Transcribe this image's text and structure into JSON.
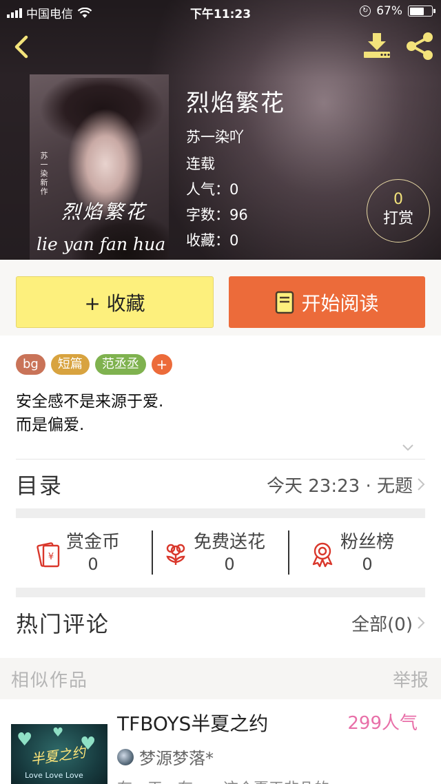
{
  "status_bar": {
    "carrier": "中国电信",
    "time": "下午11:23",
    "battery": "67%",
    "battery_level": 0.67
  },
  "colors": {
    "favorite_button": "#fdf07d",
    "read_button": "#ec6b3a",
    "accent_yellow": "#f3e37b",
    "popularity_pink": "#e86fa8"
  },
  "header": {
    "back_icon": "chevron-left-icon",
    "download_icon": "download-icon",
    "share_icon": "share-icon"
  },
  "book": {
    "cover_side_text": "苏一染新作",
    "cover_title": "烈焰繁花",
    "cover_pinyin": "lie yan fan hua",
    "title": "烈焰繁花",
    "author": "苏一染吖",
    "status": "连载",
    "popularity": "人气：0",
    "word_count": "字数：96",
    "favorites": "收藏：0"
  },
  "tip": {
    "count": "0",
    "label": "打赏"
  },
  "actions": {
    "favorite_label": "+ 收藏",
    "read_label": "开始阅读"
  },
  "tags": [
    {
      "label": "bg",
      "color": "#c97358"
    },
    {
      "label": "短篇",
      "color": "#d8a33f"
    },
    {
      "label": "范丞丞",
      "color": "#7fb24f"
    },
    {
      "label": "+",
      "color": "#ec6b3a"
    }
  ],
  "synopsis": {
    "line1": "安全感不是来源于爱.",
    "line2": "而是偏爱."
  },
  "catalog": {
    "label": "目录",
    "latest": "今天 23:23 · 无题"
  },
  "stats": [
    {
      "label": "赏金币",
      "value": "0",
      "icon": "red-envelope-icon"
    },
    {
      "label": "免费送花",
      "value": "0",
      "icon": "flower-icon"
    },
    {
      "label": "粉丝榜",
      "value": "0",
      "icon": "medal-icon"
    }
  ],
  "comments": {
    "label": "热门评论",
    "all": "全部(0)"
  },
  "similar": {
    "label": "相似作品",
    "report": "举报"
  },
  "recommendation": {
    "title": "TFBOYS半夏之约",
    "popularity": "299人气",
    "author": "梦源梦落*",
    "cover_title": "半夏之约",
    "cover_text": "Love Love Love",
    "description": "有一天，有一一这个夏天非凡的"
  }
}
